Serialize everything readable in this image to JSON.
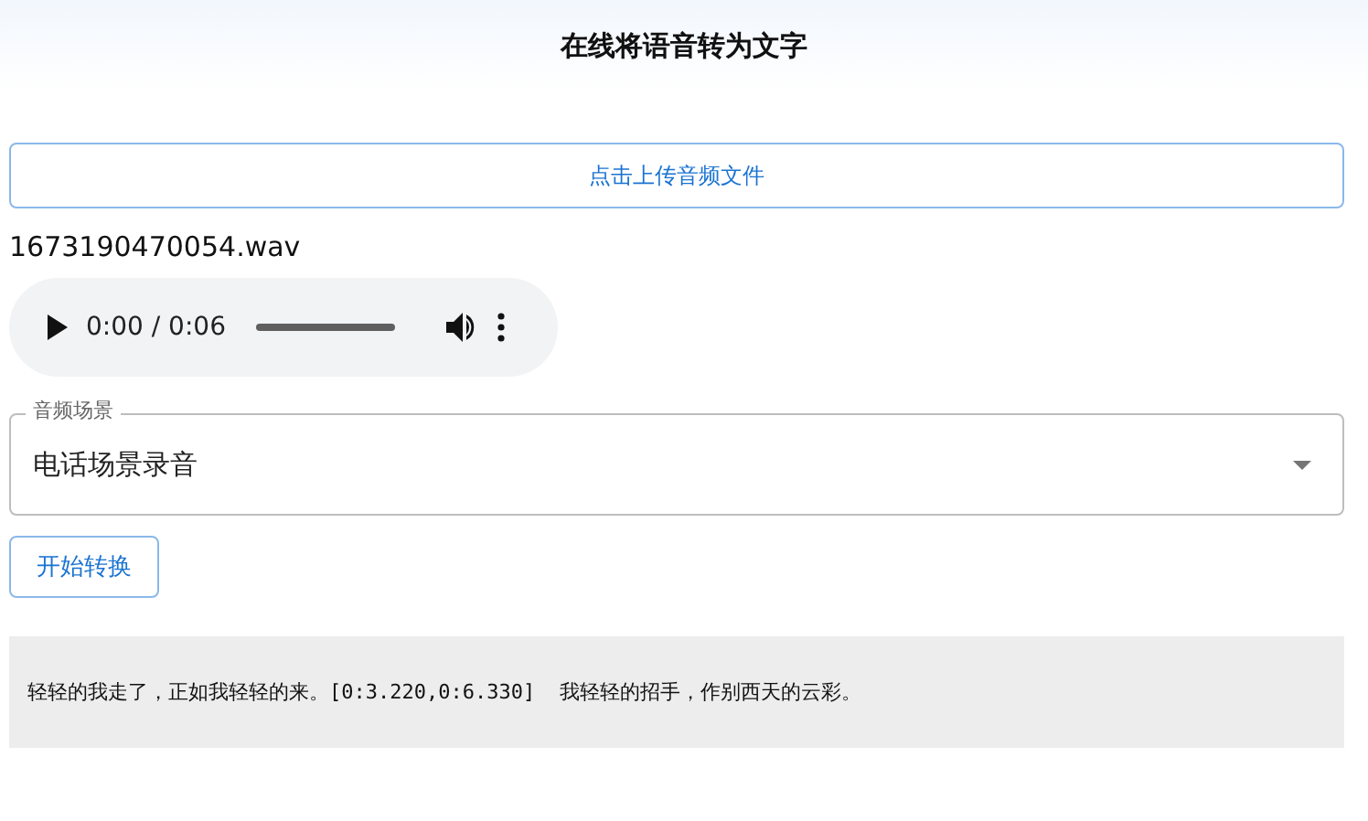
{
  "title": "在线将语音转为文字",
  "upload_button": "点击上传音频文件",
  "file_name": "1673190470054.wav",
  "audio_player": {
    "time": "0:00 / 0:06"
  },
  "scene_select": {
    "label": "音频场景",
    "value": "电话场景录音"
  },
  "start_button": "开始转换",
  "result": "轻轻的我走了，正如我轻轻的来。[0:3.220,0:6.330]  我轻轻的招手，作别西天的云彩。"
}
